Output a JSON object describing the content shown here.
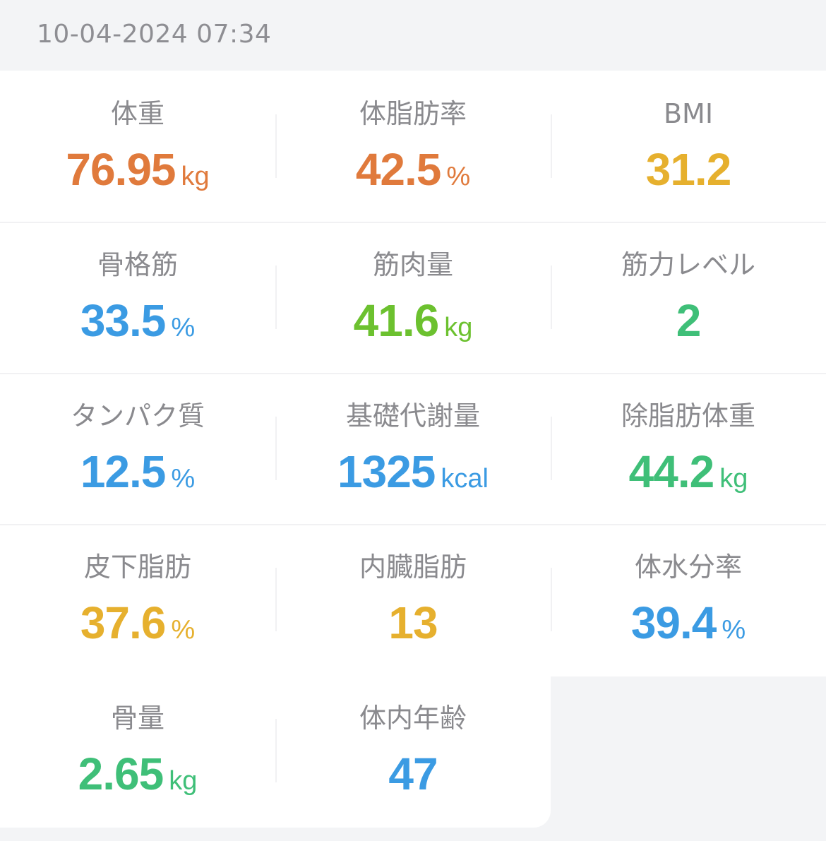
{
  "header": {
    "timestamp": "10-04-2024 07:34"
  },
  "colors": {
    "orange": "#e07a3c",
    "yellow": "#e6b02e",
    "blue": "#3b9be3",
    "lime": "#6cc12f",
    "green": "#3fbf78"
  },
  "metrics": [
    {
      "label": "体重",
      "value": "76.95",
      "unit": "kg",
      "color": "#e07a3c"
    },
    {
      "label": "体脂肪率",
      "value": "42.5",
      "unit": "%",
      "color": "#e07a3c"
    },
    {
      "label": "BMI",
      "value": "31.2",
      "unit": "",
      "color": "#e6b02e"
    },
    {
      "label": "骨格筋",
      "value": "33.5",
      "unit": "%",
      "color": "#3b9be3"
    },
    {
      "label": "筋肉量",
      "value": "41.6",
      "unit": "kg",
      "color": "#6cc12f"
    },
    {
      "label": "筋力レベル",
      "value": "2",
      "unit": "",
      "color": "#3fbf78"
    },
    {
      "label": "タンパク質",
      "value": "12.5",
      "unit": "%",
      "color": "#3b9be3"
    },
    {
      "label": "基礎代謝量",
      "value": "1325",
      "unit": "kcal",
      "color": "#3b9be3"
    },
    {
      "label": "除脂肪体重",
      "value": "44.2",
      "unit": "kg",
      "color": "#3fbf78"
    },
    {
      "label": "皮下脂肪",
      "value": "37.6",
      "unit": "%",
      "color": "#e6b02e"
    },
    {
      "label": "内臓脂肪",
      "value": "13",
      "unit": "",
      "color": "#e6b02e"
    },
    {
      "label": "体水分率",
      "value": "39.4",
      "unit": "%",
      "color": "#3b9be3"
    },
    {
      "label": "骨量",
      "value": "2.65",
      "unit": "kg",
      "color": "#3fbf78"
    },
    {
      "label": "体内年齢",
      "value": "47",
      "unit": "",
      "color": "#3b9be3"
    }
  ]
}
